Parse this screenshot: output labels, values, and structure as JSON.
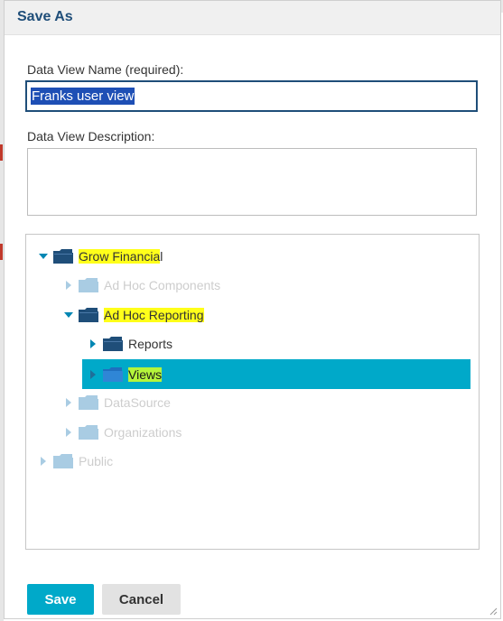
{
  "dialog": {
    "title": "Save As",
    "name_label": "Data View Name (required):",
    "name_value": "Franks user view",
    "description_label": "Data View Description:",
    "description_value": ""
  },
  "tree": {
    "nodes": [
      {
        "label_a": "Grow Financia",
        "label_b": "l",
        "expanded": true,
        "enabled": true
      },
      {
        "label": "Ad Hoc Components",
        "expanded": false,
        "enabled": false
      },
      {
        "label": "Ad Hoc Reporting",
        "expanded": true,
        "enabled": true
      },
      {
        "label": "Reports",
        "expanded": false,
        "enabled": true
      },
      {
        "label": "Views",
        "expanded": false,
        "enabled": true,
        "selected": true
      },
      {
        "label": "DataSource",
        "expanded": false,
        "enabled": false
      },
      {
        "label": "Organizations",
        "expanded": false,
        "enabled": false
      },
      {
        "label": "Public",
        "expanded": false,
        "enabled": false
      }
    ]
  },
  "buttons": {
    "save": "Save",
    "cancel": "Cancel"
  },
  "colors": {
    "title": "#1f4e79",
    "accent": "#00a9c9",
    "folder": "#1f4e79",
    "folder_disabled": "#a9cce3",
    "highlight": "#ffff1a",
    "selection": "#1e4fb5"
  }
}
